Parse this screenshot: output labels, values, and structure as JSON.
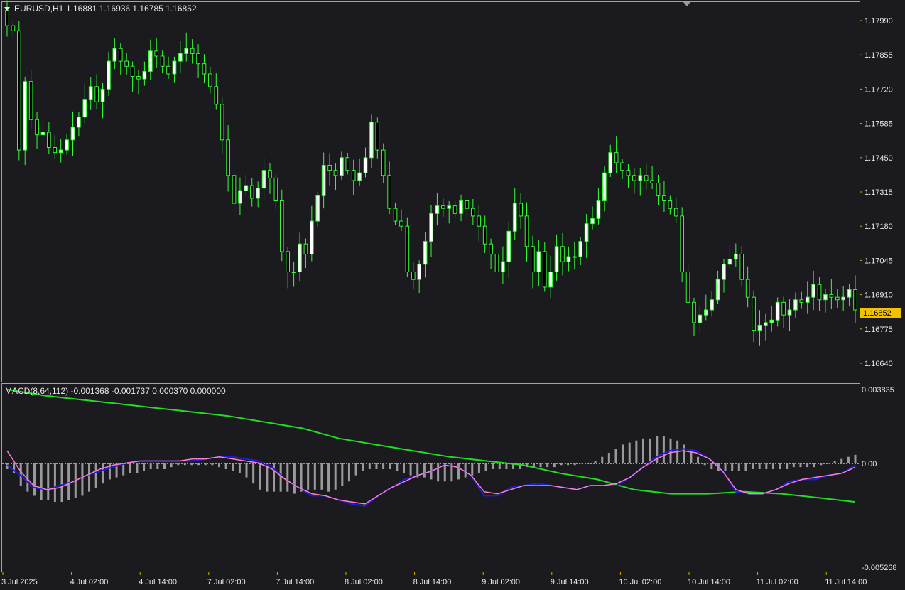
{
  "header": {
    "symbol": "EURUSD,H1",
    "ohlc": "1.16881 1.16936 1.16785 1.16852",
    "indicator": "MACD(8,64,112) -0.001368 -0.001737 0.000370 0.000000"
  },
  "price_axis": {
    "ticks": [
      "1.17990",
      "1.17855",
      "1.17720",
      "1.17585",
      "1.17450",
      "1.17315",
      "1.17180",
      "1.17045",
      "1.16910",
      "1.16775",
      "1.16640"
    ],
    "current": "1.16852"
  },
  "macd_axis": {
    "top": "0.003835",
    "zero": "0.00",
    "bottom": "-0.005268"
  },
  "time_axis": [
    "3 Jul 2025",
    "4 Jul 02:00",
    "4 Jul 14:00",
    "7 Jul 02:00",
    "7 Jul 14:00",
    "8 Jul 02:00",
    "8 Jul 14:00",
    "9 Jul 02:00",
    "9 Jul 14:00",
    "10 Jul 02:00",
    "10 Jul 14:00",
    "11 Jul 02:00",
    "11 Jul 14:00"
  ],
  "colors": {
    "background": "#1b1b1f",
    "frame": "#c8b400",
    "bull_candle": "#ffffff",
    "candle_outline": "#33ff33",
    "bear_candle": "#000000",
    "histogram": "#9a9a9a",
    "macd_line": "#1c1ce0",
    "signal_line": "#ff7fc8",
    "slow_line": "#22dd22",
    "current_price_bg": "#f2c200"
  },
  "chart_data": [
    {
      "type": "candlestick",
      "title": "EURUSD,H1",
      "ylim": [
        1.1657,
        1.1806
      ],
      "closes": [
        1.1797,
        1.1795,
        1.1748,
        1.1775,
        1.176,
        1.1754,
        1.1755,
        1.1749,
        1.1747,
        1.1748,
        1.1752,
        1.1757,
        1.1761,
        1.1768,
        1.1773,
        1.1767,
        1.1772,
        1.1783,
        1.1788,
        1.1783,
        1.1781,
        1.1777,
        1.1776,
        1.1779,
        1.1787,
        1.1785,
        1.1781,
        1.1778,
        1.1783,
        1.1786,
        1.1788,
        1.1786,
        1.1782,
        1.1778,
        1.1773,
        1.1766,
        1.1752,
        1.1738,
        1.1727,
        1.1732,
        1.1734,
        1.1729,
        1.1733,
        1.174,
        1.1737,
        1.1728,
        1.1708,
        1.17,
        1.17,
        1.1711,
        1.1707,
        1.172,
        1.173,
        1.1742,
        1.174,
        1.1738,
        1.1745,
        1.174,
        1.1736,
        1.1739,
        1.1745,
        1.1759,
        1.1748,
        1.1738,
        1.1725,
        1.172,
        1.1718,
        1.17,
        1.1697,
        1.1703,
        1.1712,
        1.1723,
        1.1726,
        1.1725,
        1.1726,
        1.1723,
        1.1728,
        1.1725,
        1.1722,
        1.1718,
        1.1711,
        1.1707,
        1.17,
        1.1704,
        1.1716,
        1.1727,
        1.1722,
        1.171,
        1.17,
        1.1708,
        1.1694,
        1.17,
        1.171,
        1.1704,
        1.1706,
        1.1706,
        1.1712,
        1.1719,
        1.1721,
        1.1728,
        1.1739,
        1.1747,
        1.1743,
        1.174,
        1.1738,
        1.1736,
        1.1738,
        1.1736,
        1.1735,
        1.173,
        1.1728,
        1.1725,
        1.1722,
        1.17,
        1.1688,
        1.168,
        1.1683,
        1.1685,
        1.1689,
        1.1697,
        1.1703,
        1.1705,
        1.1707,
        1.1697,
        1.169,
        1.1677,
        1.1679,
        1.168,
        1.1681,
        1.1688,
        1.1683,
        1.1685,
        1.1689,
        1.1688,
        1.169,
        1.1695,
        1.1689,
        1.1691,
        1.169,
        1.1689,
        1.169,
        1.1693,
        1.1685
      ]
    },
    {
      "type": "bar",
      "title": "MACD(8,64,112)",
      "ylim": [
        -0.005268,
        0.003835
      ],
      "hist": [
        -0.0003,
        -0.0005,
        -0.0011,
        -0.0014,
        -0.0016,
        -0.0018,
        -0.0018,
        -0.0019,
        -0.0019,
        -0.0018,
        -0.0017,
        -0.0016,
        -0.0014,
        -0.0012,
        -0.001,
        -0.0008,
        -0.0007,
        -0.0006,
        -0.0005,
        -0.0005,
        -0.0004,
        -0.0003,
        -0.0003,
        -0.0003,
        -0.0002,
        -0.0001,
        -0.0001,
        -0.0001,
        -0.0001,
        -0.0001,
        -0.0001,
        -0.0002,
        -0.0003,
        -0.0004,
        -0.0005,
        -0.0007,
        -0.001,
        -0.0013,
        -0.0014,
        -0.0014,
        -0.0014,
        -0.0014,
        -0.0015,
        -0.0014,
        -0.0013,
        -0.0013,
        -0.0013,
        -0.0014,
        -0.0013,
        -0.0011,
        -0.0009,
        -0.0006,
        -0.0004,
        -0.0003,
        -0.0003,
        -0.0003,
        -0.0003,
        -0.0004,
        -0.0005,
        -0.0006,
        -0.0007,
        -0.0007,
        -0.0008,
        -0.0009,
        -0.0009,
        -0.0009,
        -0.0008,
        -0.0007,
        -0.0006,
        -0.0005,
        -0.0004,
        -0.0003,
        -0.0003,
        -0.0003,
        -0.0003,
        -0.0003,
        -0.0002,
        -0.0002,
        -0.0002,
        -0.0002,
        -0.0002,
        -0.0001,
        -0.0001,
        -0.0001,
        0.0,
        0.0,
        0.0001,
        0.0003,
        0.0005,
        0.0007,
        0.0009,
        0.001,
        0.0011,
        0.0012,
        0.0012,
        0.0013,
        0.0013,
        0.0012,
        0.0011,
        0.0009,
        0.0006,
        0.0003,
        -0.0001,
        -0.0003,
        -0.0004,
        -0.0004,
        -0.0004,
        -0.0004,
        -0.0004,
        -0.0003,
        -0.0003,
        -0.0003,
        -0.0003,
        -0.0003,
        -0.0003,
        -0.0002,
        -0.0002,
        -0.0002,
        -0.0002,
        -0.0001,
        0.0,
        0.0001,
        0.0002,
        0.0003,
        0.0004
      ],
      "macd": [
        -0.0001,
        -0.0006,
        -0.0012,
        -0.0013,
        -0.0011,
        -0.0009,
        -0.0006,
        -0.0004,
        -0.0002,
        0.0,
        0.0001,
        0.0001,
        0.0001,
        0.0001,
        0.0001,
        0.0002,
        0.0003,
        0.0003,
        0.0002,
        0.0001,
        -0.0002,
        -0.0008,
        -0.0012,
        -0.0016,
        -0.0016,
        -0.0018,
        -0.002,
        -0.0021,
        -0.0016,
        -0.0012,
        -0.0008,
        -0.0006,
        -0.0004,
        -0.0001,
        -0.0002,
        -0.0006,
        -0.0016,
        -0.0016,
        -0.0012,
        -0.0011,
        -0.001,
        -0.0011,
        -0.0012,
        -0.0013,
        -0.0011,
        -0.0011,
        -0.0011,
        -0.0007,
        -0.0002,
        0.0003,
        0.0006,
        0.0007,
        0.0006,
        0.0002,
        -0.0004,
        -0.0014,
        -0.0015,
        -0.0015,
        -0.0013,
        -0.0009,
        -0.0008,
        -0.0008,
        -0.0006,
        -0.0005,
        -0.0001
      ],
      "signal": [
        0.0006,
        -0.0004,
        -0.0011,
        -0.0013,
        -0.0012,
        -0.0009,
        -0.0006,
        -0.0003,
        -0.0001,
        0.0,
        0.0001,
        0.0001,
        0.0001,
        0.0001,
        0.0002,
        0.0002,
        0.0003,
        0.0002,
        0.0001,
        0.0,
        -0.0003,
        -0.0008,
        -0.0012,
        -0.0015,
        -0.0016,
        -0.0018,
        -0.0019,
        -0.002,
        -0.0016,
        -0.0012,
        -0.0009,
        -0.0006,
        -0.0004,
        -0.0001,
        -0.0002,
        -0.0006,
        -0.0014,
        -0.0015,
        -0.0013,
        -0.0011,
        -0.0011,
        -0.0011,
        -0.0012,
        -0.0013,
        -0.0011,
        -0.0011,
        -0.001,
        -0.0007,
        -0.0002,
        0.0002,
        0.0005,
        0.0006,
        0.0005,
        0.0002,
        -0.0004,
        -0.0013,
        -0.0015,
        -0.0015,
        -0.0013,
        -0.001,
        -0.0008,
        -0.0007,
        -0.0006,
        -0.0005,
        -0.0002
      ],
      "slow": [
        0.0036,
        0.0033,
        0.0031,
        0.0029,
        0.0027,
        0.0025,
        0.0023,
        0.002,
        0.0017,
        0.0012,
        0.0009,
        0.0006,
        0.0003,
        0.0001,
        -0.0001,
        -0.0005,
        -0.0008,
        -0.0013,
        -0.0015,
        -0.0015,
        -0.0014,
        -0.0015,
        -0.0017,
        -0.0019
      ]
    }
  ]
}
